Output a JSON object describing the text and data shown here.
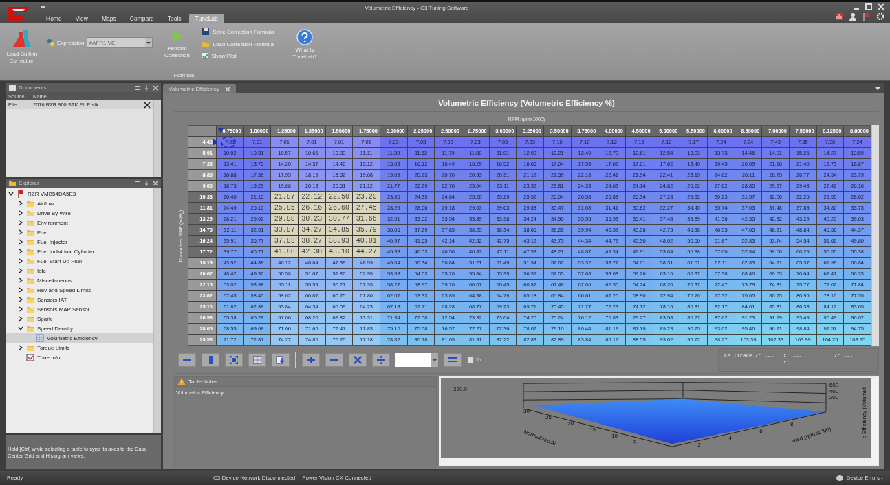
{
  "window": {
    "title": "Volumetric Efficiency - C3 Tuning Software"
  },
  "app_tabs": [
    {
      "label": "Home",
      "selected": false
    },
    {
      "label": "View",
      "selected": false
    },
    {
      "label": "Maps",
      "selected": false
    },
    {
      "label": "Compare",
      "selected": false
    },
    {
      "label": "Tools",
      "selected": false
    },
    {
      "label": "TuneLab",
      "selected": true
    }
  ],
  "ribbon": {
    "load_builtin": "Load Built-in Correction",
    "expression_label": "Expression",
    "expression_value": "#AFR1 VE",
    "perform": "Perform Correction",
    "save": "Save Correction Formula",
    "load": "Load Correction Formula",
    "show_plot": {
      "label": "Show Plot",
      "checked": true
    },
    "help": "What Is TuneLab?",
    "group_label": "Formula"
  },
  "documents": {
    "title": "Documents",
    "columns": [
      "Source",
      "Name"
    ],
    "rows": [
      {
        "source": "File",
        "name": "2016 RZR 900 STK FILE.stk"
      }
    ]
  },
  "explorer": {
    "title": "Explorer",
    "tree": [
      {
        "label": "RZR VMB54DA5E3",
        "kind": "vehicle",
        "expanded": true,
        "selected": false,
        "children": [
          {
            "label": "Airflow",
            "kind": "folder",
            "expanded": false,
            "selected": false
          },
          {
            "label": "Drive By Wire",
            "kind": "folder",
            "expanded": false,
            "selected": false
          },
          {
            "label": "Environment",
            "kind": "folder",
            "expanded": false,
            "selected": false
          },
          {
            "label": "Fuel",
            "kind": "folder",
            "expanded": false,
            "selected": false
          },
          {
            "label": "Fuel Injector",
            "kind": "folder",
            "expanded": false,
            "selected": false
          },
          {
            "label": "Fuel Individual Cylinder",
            "kind": "folder",
            "expanded": false,
            "selected": false
          },
          {
            "label": "Fuel Start Up Fuel",
            "kind": "folder",
            "expanded": false,
            "selected": false
          },
          {
            "label": "Idle",
            "kind": "folder",
            "expanded": false,
            "selected": false
          },
          {
            "label": "Miscellaneous",
            "kind": "folder",
            "expanded": false,
            "selected": false
          },
          {
            "label": "Rev and Speed Limits",
            "kind": "folder",
            "expanded": false,
            "selected": false
          },
          {
            "label": "Sensors.IAT",
            "kind": "folder",
            "expanded": false,
            "selected": false
          },
          {
            "label": "Sensors.MAP Sensor",
            "kind": "folder",
            "expanded": false,
            "selected": false
          },
          {
            "label": "Spark",
            "kind": "folder",
            "expanded": false,
            "selected": false
          },
          {
            "label": "Speed Density",
            "kind": "folder",
            "expanded": true,
            "selected": false,
            "children": [
              {
                "label": "Volumetric Efficiency",
                "kind": "table",
                "selected": true
              }
            ]
          },
          {
            "label": "Torque Limits",
            "kind": "folder",
            "expanded": false,
            "selected": false
          },
          {
            "label": "Tune Info",
            "kind": "info",
            "selected": false
          }
        ]
      }
    ]
  },
  "hint": "Hold [Ctrl] while selecting a table to sync its axes to the Data Center Grid and Histogram views.",
  "doc_tab": {
    "label": "Volumetric Efficiency"
  },
  "table": {
    "title": "Volumetric Efficiency (Volumetric Efficiency %)",
    "x_label": "RPM (rpmx1000)",
    "y_label": "Normalized MAP (in-Hg)",
    "columns": [
      "0.75000",
      "1.00000",
      "1.25000",
      "1.35000",
      "1.50000",
      "1.75000",
      "2.00000",
      "2.25000",
      "2.50000",
      "2.75000",
      "3.00000",
      "3.25000",
      "3.50000",
      "3.75000",
      "4.00000",
      "4.50000",
      "5.00000",
      "5.50000",
      "6.00000",
      "6.50000",
      "7.00000",
      "7.50000",
      "8.12500",
      "8.80000"
    ],
    "rows": [
      {
        "label": "4.43",
        "selected": false,
        "cursor": true,
        "cells": [
          "7.01",
          "7.01",
          "7.01",
          "7.01",
          "7.01",
          "7.01",
          "7.03",
          "7.03",
          "7.03",
          "7.03",
          "7.03",
          "7.03",
          "7.10",
          "7.12",
          "7.12",
          "7.15",
          "7.12",
          "7.17",
          "7.24",
          "7.24",
          "7.43",
          "7.35",
          "7.30",
          "7.24"
        ],
        "cell_selected": [
          false,
          false,
          false,
          false,
          false,
          false,
          false,
          false,
          false,
          false,
          false,
          false,
          false,
          false,
          false,
          false,
          false,
          false,
          false,
          false,
          false,
          false,
          false,
          false
        ]
      },
      {
        "label": "5.91",
        "selected": false,
        "cursor": false,
        "cells": [
          "10.02",
          "10.31",
          "10.57",
          "10.66",
          "10.83",
          "11.11",
          "11.39",
          "11.62",
          "11.79",
          "11.88",
          "11.91",
          "12.00",
          "12.21",
          "12.49",
          "12.70",
          "12.61",
          "12.54",
          "13.01",
          "13.73",
          "14.46",
          "14.91",
          "15.26",
          "14.27",
          "13.59"
        ],
        "cell_selected": [
          false,
          false,
          false,
          false,
          false,
          false,
          false,
          false,
          false,
          false,
          false,
          false,
          false,
          false,
          false,
          false,
          false,
          false,
          false,
          false,
          false,
          false,
          false,
          false
        ]
      },
      {
        "label": "7.38",
        "selected": false,
        "cursor": false,
        "cells": [
          "13.41",
          "13.75",
          "14.20",
          "14.37",
          "14.45",
          "13.12",
          "15.63",
          "16.12",
          "16.49",
          "16.29",
          "16.52",
          "16.66",
          "17.04",
          "17.53",
          "17.69",
          "17.61",
          "17.62",
          "18.40",
          "19.45",
          "20.69",
          "21.16",
          "21.40",
          "19.73",
          "18.87"
        ],
        "cell_selected": [
          false,
          false,
          false,
          false,
          false,
          false,
          false,
          false,
          false,
          false,
          false,
          false,
          false,
          false,
          false,
          false,
          false,
          false,
          false,
          false,
          false,
          false,
          false,
          false
        ]
      },
      {
        "label": "8.86",
        "selected": false,
        "cursor": false,
        "cells": [
          "16.88",
          "17.39",
          "17.95",
          "18.19",
          "18.52",
          "19.08",
          "19.69",
          "20.23",
          "20.70",
          "20.93",
          "20.91",
          "21.12",
          "21.59",
          "22.18",
          "22.41",
          "21.94",
          "22.41",
          "23.15",
          "24.62",
          "26.11",
          "26.75",
          "26.77",
          "24.54",
          "23.79"
        ],
        "cell_selected": [
          false,
          false,
          false,
          false,
          false,
          false,
          false,
          false,
          false,
          false,
          false,
          false,
          false,
          false,
          false,
          false,
          false,
          false,
          false,
          false,
          false,
          false,
          false,
          false
        ]
      },
      {
        "label": "9.60",
        "selected": false,
        "cursor": false,
        "cells": [
          "18.73",
          "19.29",
          "19.88",
          "20.13",
          "20.51",
          "21.12",
          "21.77",
          "22.29",
          "22.70",
          "23.04",
          "23.11",
          "23.32",
          "23.81",
          "24.33",
          "24.63",
          "24.14",
          "24.82",
          "26.22",
          "27.62",
          "28.85",
          "29.27",
          "29.48",
          "27.42",
          "26.16"
        ],
        "cell_selected": [
          false,
          false,
          false,
          false,
          false,
          false,
          false,
          false,
          false,
          false,
          false,
          false,
          false,
          false,
          false,
          false,
          false,
          false,
          false,
          false,
          false,
          false,
          false,
          false
        ]
      },
      {
        "label": "10.33",
        "selected": true,
        "cursor": false,
        "cells": [
          "20.40",
          "21.15",
          "21.87",
          "22.12",
          "22.50",
          "23.20",
          "23.86",
          "24.35",
          "24.84",
          "25.20",
          "25.29",
          "25.52",
          "26.04",
          "26.58",
          "26.88",
          "26.34",
          "27.28",
          "29.32",
          "30.23",
          "31.57",
          "32.06",
          "32.25",
          "29.55",
          "28.62"
        ],
        "cell_selected": [
          false,
          false,
          true,
          true,
          true,
          true,
          false,
          false,
          false,
          false,
          false,
          false,
          false,
          false,
          false,
          false,
          false,
          false,
          false,
          false,
          false,
          false,
          false,
          false
        ]
      },
      {
        "label": "11.81",
        "selected": true,
        "cursor": false,
        "cells": [
          "24.49",
          "25.10",
          "25.85",
          "26.16",
          "26.60",
          "27.45",
          "28.29",
          "28.66",
          "29.18",
          "29.63",
          "29.63",
          "29.88",
          "30.47",
          "31.08",
          "31.41",
          "30.82",
          "32.27",
          "34.45",
          "35.74",
          "37.03",
          "37.48",
          "37.83",
          "34.80",
          "33.73"
        ],
        "cell_selected": [
          false,
          false,
          true,
          true,
          true,
          true,
          false,
          false,
          false,
          false,
          false,
          false,
          false,
          false,
          false,
          false,
          false,
          false,
          false,
          false,
          false,
          false,
          false,
          false
        ]
      },
      {
        "label": "13.29",
        "selected": true,
        "cursor": false,
        "cells": [
          "28.21",
          "29.02",
          "29.88",
          "30.23",
          "30.77",
          "31.66",
          "32.51",
          "33.02",
          "33.54",
          "33.89",
          "33.98",
          "34.24",
          "34.90",
          "35.55",
          "35.93",
          "35.41",
          "37.48",
          "39.89",
          "41.36",
          "42.35",
          "42.82",
          "43.29",
          "40.20",
          "39.03"
        ],
        "cell_selected": [
          false,
          false,
          true,
          true,
          true,
          true,
          false,
          false,
          false,
          false,
          false,
          false,
          false,
          false,
          false,
          false,
          false,
          false,
          false,
          false,
          false,
          false,
          false,
          false
        ]
      },
      {
        "label": "14.76",
        "selected": true,
        "cursor": false,
        "cells": [
          "32.11",
          "32.91",
          "33.87",
          "34.27",
          "34.85",
          "35.79",
          "36.66",
          "37.29",
          "37.85",
          "38.25",
          "38.34",
          "38.65",
          "39.28",
          "39.94",
          "40.59",
          "40.56",
          "42.75",
          "45.38",
          "46.55",
          "47.65",
          "48.21",
          "48.84",
          "45.56",
          "44.37"
        ],
        "cell_selected": [
          false,
          false,
          true,
          true,
          true,
          true,
          false,
          false,
          false,
          false,
          false,
          false,
          false,
          false,
          false,
          false,
          false,
          false,
          false,
          false,
          false,
          false,
          false,
          false
        ]
      },
      {
        "label": "16.24",
        "selected": true,
        "cursor": false,
        "cells": [
          "35.91",
          "36.77",
          "37.83",
          "38.27",
          "38.93",
          "40.01",
          "40.97",
          "41.65",
          "42.14",
          "42.52",
          "42.75",
          "43.12",
          "43.73",
          "44.34",
          "44.79",
          "45.30",
          "48.02",
          "50.60",
          "51.87",
          "52.83",
          "53.74",
          "54.54",
          "51.62",
          "49.80"
        ],
        "cell_selected": [
          false,
          false,
          true,
          true,
          true,
          true,
          false,
          false,
          false,
          false,
          false,
          false,
          false,
          false,
          false,
          false,
          false,
          false,
          false,
          false,
          false,
          false,
          false,
          false
        ]
      },
      {
        "label": "17.72",
        "selected": true,
        "cursor": false,
        "cells": [
          "39.77",
          "40.71",
          "41.88",
          "42.38",
          "43.10",
          "44.27",
          "45.33",
          "46.03",
          "46.50",
          "46.83",
          "47.11",
          "47.53",
          "48.21",
          "48.87",
          "49.34",
          "49.91",
          "53.04",
          "55.88",
          "57.00",
          "57.84",
          "59.06",
          "60.29",
          "56.55",
          "55.38"
        ],
        "cell_selected": [
          false,
          false,
          true,
          true,
          true,
          true,
          false,
          false,
          false,
          false,
          false,
          false,
          false,
          false,
          false,
          false,
          false,
          false,
          false,
          false,
          false,
          false,
          false,
          false
        ]
      },
      {
        "label": "19.19",
        "selected": false,
        "cursor": false,
        "cells": [
          "43.92",
          "44.88",
          "46.12",
          "46.64",
          "47.39",
          "48.59",
          "49.64",
          "50.34",
          "50.84",
          "51.21",
          "51.49",
          "51.94",
          "52.62",
          "53.32",
          "53.77",
          "54.61",
          "58.31",
          "61.01",
          "62.11",
          "62.83",
          "64.21",
          "65.37",
          "61.99",
          "60.84"
        ],
        "cell_selected": [
          false,
          false,
          false,
          false,
          false,
          false,
          false,
          false,
          false,
          false,
          false,
          false,
          false,
          false,
          false,
          false,
          false,
          false,
          false,
          false,
          false,
          false,
          false,
          false
        ]
      },
      {
        "label": "20.67",
        "selected": false,
        "cursor": false,
        "cells": [
          "48.42",
          "49.36",
          "50.58",
          "51.07",
          "51.80",
          "52.95",
          "53.93",
          "54.63",
          "55.20",
          "55.84",
          "55.95",
          "56.39",
          "57.05",
          "57.68",
          "58.08",
          "59.26",
          "63.16",
          "66.37",
          "67.38",
          "68.46",
          "69.55",
          "70.64",
          "67.41",
          "66.33"
        ],
        "cell_selected": [
          false,
          false,
          false,
          false,
          false,
          false,
          false,
          false,
          false,
          false,
          false,
          false,
          false,
          false,
          false,
          false,
          false,
          false,
          false,
          false,
          false,
          false,
          false,
          false
        ]
      },
      {
        "label": "22.15",
        "selected": false,
        "cursor": false,
        "cells": [
          "53.02",
          "53.98",
          "55.11",
          "55.59",
          "56.27",
          "57.35",
          "58.27",
          "58.97",
          "59.10",
          "60.07",
          "60.45",
          "60.87",
          "61.48",
          "62.06",
          "62.50",
          "64.24",
          "68.20",
          "70.37",
          "72.47",
          "73.79",
          "74.81",
          "75.77",
          "72.62",
          "71.84"
        ],
        "cell_selected": [
          false,
          false,
          false,
          false,
          false,
          false,
          false,
          false,
          false,
          false,
          false,
          false,
          false,
          false,
          false,
          false,
          false,
          false,
          false,
          false,
          false,
          false,
          false,
          false
        ]
      },
      {
        "label": "23.62",
        "selected": false,
        "cursor": false,
        "cells": [
          "57.45",
          "58.40",
          "59.62",
          "60.07",
          "60.75",
          "61.80",
          "62.67",
          "63.33",
          "63.89",
          "64.38",
          "64.79",
          "65.18",
          "65.84",
          "66.61",
          "67.26",
          "68.90",
          "72.94",
          "75.70",
          "77.32",
          "79.05",
          "80.25",
          "80.95",
          "78.16",
          "77.55"
        ],
        "cell_selected": [
          false,
          false,
          false,
          false,
          false,
          false,
          false,
          false,
          false,
          false,
          false,
          false,
          false,
          false,
          false,
          false,
          false,
          false,
          false,
          false,
          false,
          false,
          false,
          false
        ]
      },
      {
        "label": "25.10",
        "selected": false,
        "cursor": false,
        "cells": [
          "61.82",
          "62.88",
          "63.84",
          "64.34",
          "65.09",
          "64.23",
          "67.18",
          "67.71",
          "68.28",
          "68.77",
          "69.23",
          "69.71",
          "70.45",
          "71.27",
          "72.23",
          "74.12",
          "78.16",
          "80.81",
          "82.17",
          "84.61",
          "85.81",
          "86.38",
          "84.12",
          "83.65"
        ],
        "cell_selected": [
          false,
          false,
          false,
          false,
          false,
          false,
          false,
          false,
          false,
          false,
          false,
          false,
          false,
          false,
          false,
          false,
          false,
          false,
          false,
          false,
          false,
          false,
          false,
          false
        ]
      },
      {
        "label": "26.58",
        "selected": false,
        "cursor": false,
        "cells": [
          "65.38",
          "66.28",
          "67.66",
          "68.20",
          "69.82",
          "73.31",
          "71.34",
          "72.00",
          "72.54",
          "73.32",
          "73.64",
          "74.20",
          "75.24",
          "76.12",
          "76.83",
          "79.27",
          "83.58",
          "86.27",
          "87.62",
          "91.23",
          "91.29",
          "93.49",
          "90.49",
          "90.02"
        ],
        "cell_selected": [
          false,
          false,
          false,
          false,
          false,
          false,
          false,
          false,
          false,
          false,
          false,
          false,
          false,
          false,
          false,
          false,
          false,
          false,
          false,
          false,
          false,
          false,
          false,
          false
        ]
      },
      {
        "label": "28.05",
        "selected": false,
        "cursor": false,
        "cells": [
          "68.55",
          "69.68",
          "71.06",
          "71.65",
          "72.47",
          "71.83",
          "75.16",
          "75.68",
          "76.57",
          "77.27",
          "77.36",
          "78.02",
          "79.10",
          "80.44",
          "81.19",
          "81.79",
          "89.23",
          "90.75",
          "93.02",
          "95.46",
          "96.71",
          "98.84",
          "97.57",
          "94.75"
        ],
        "cell_selected": [
          false,
          false,
          false,
          false,
          false,
          false,
          false,
          false,
          false,
          false,
          false,
          false,
          false,
          false,
          false,
          false,
          false,
          false,
          false,
          false,
          false,
          false,
          false,
          false
        ]
      },
      {
        "label": "29.53",
        "selected": false,
        "cursor": false,
        "cells": [
          "71.72",
          "72.87",
          "74.27",
          "74.86",
          "75.70",
          "77.18",
          "78.82",
          "80.18",
          "81.05",
          "81.91",
          "82.22",
          "82.83",
          "82.89",
          "83.84",
          "85.12",
          "88.55",
          "93.02",
          "95.72",
          "98.27",
          "103.39",
          "102.33",
          "103.99",
          "104.25",
          "103.95"
        ],
        "cell_selected": [
          false,
          false,
          false,
          false,
          false,
          false,
          false,
          false,
          false,
          false,
          false,
          false,
          false,
          false,
          false,
          false,
          false,
          false,
          false,
          false,
          false,
          false,
          false,
          false
        ]
      }
    ]
  },
  "toolbar": [
    {
      "kind": "collapse"
    },
    {
      "kind": "bar"
    },
    {
      "kind": "fit"
    },
    {
      "kind": "grid"
    },
    {
      "kind": "export"
    },
    {
      "kind": "separator"
    },
    {
      "kind": "add"
    },
    {
      "kind": "subtract"
    },
    {
      "kind": "multiply"
    },
    {
      "kind": "divide"
    },
    {
      "kind": "combo"
    },
    {
      "kind": "equals"
    },
    {
      "kind": "checkbox",
      "label": "%",
      "checked": false
    }
  ],
  "celltrace": {
    "label": "CellTrace Z: ---",
    "x": "X: ---",
    "y": "Y: ---",
    "z": "Z: ---"
  },
  "notes": {
    "title": "Table Notes",
    "text": "Volumetric Efficiency"
  },
  "plot": {
    "value": "320.0",
    "z_ticks": [
      "600",
      "400",
      "200"
    ],
    "y_ticks": [
      "30",
      "25",
      "20",
      "15",
      "10",
      "5"
    ],
    "x_ticks": [
      "2",
      "4",
      "6",
      "8"
    ],
    "y_title": "Normalized Ai",
    "x_title": "med (rpmx1000)",
    "z_title": "c Efficiency (Volumet"
  },
  "status_bar": {
    "left": "Ready",
    "items": [
      "C3 Device Network Disconnected",
      "Power Vision CX Connected"
    ],
    "right": "Device Errors -"
  }
}
